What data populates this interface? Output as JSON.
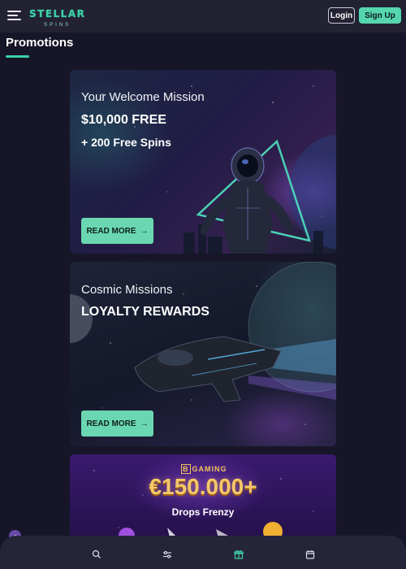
{
  "header": {
    "logo_main": "STELLAR",
    "logo_sub": "SPINS",
    "login_label": "Login",
    "signup_label": "Sign Up"
  },
  "page": {
    "title": "Promotions"
  },
  "promos": [
    {
      "kicker": "Your Welcome Mission",
      "headline": "$10,000 FREE",
      "sub": "+ 200 Free Spins",
      "button": "READ MORE"
    },
    {
      "kicker": "Cosmic Missions",
      "headline": "LOYALTY REWARDS",
      "button": "READ MORE"
    },
    {
      "brand": "GAMING",
      "brand_mark": "B",
      "amount": "€150.000+",
      "sub": "Drops Frenzy"
    }
  ],
  "bottom_nav": [
    {
      "icon": "search-icon"
    },
    {
      "icon": "sliders-icon"
    },
    {
      "icon": "gift-icon",
      "active": true
    },
    {
      "icon": "calendar-icon"
    }
  ],
  "colors": {
    "accent": "#3ecfa6",
    "button": "#6ad7b2",
    "background": "#161628",
    "header": "#222233"
  }
}
